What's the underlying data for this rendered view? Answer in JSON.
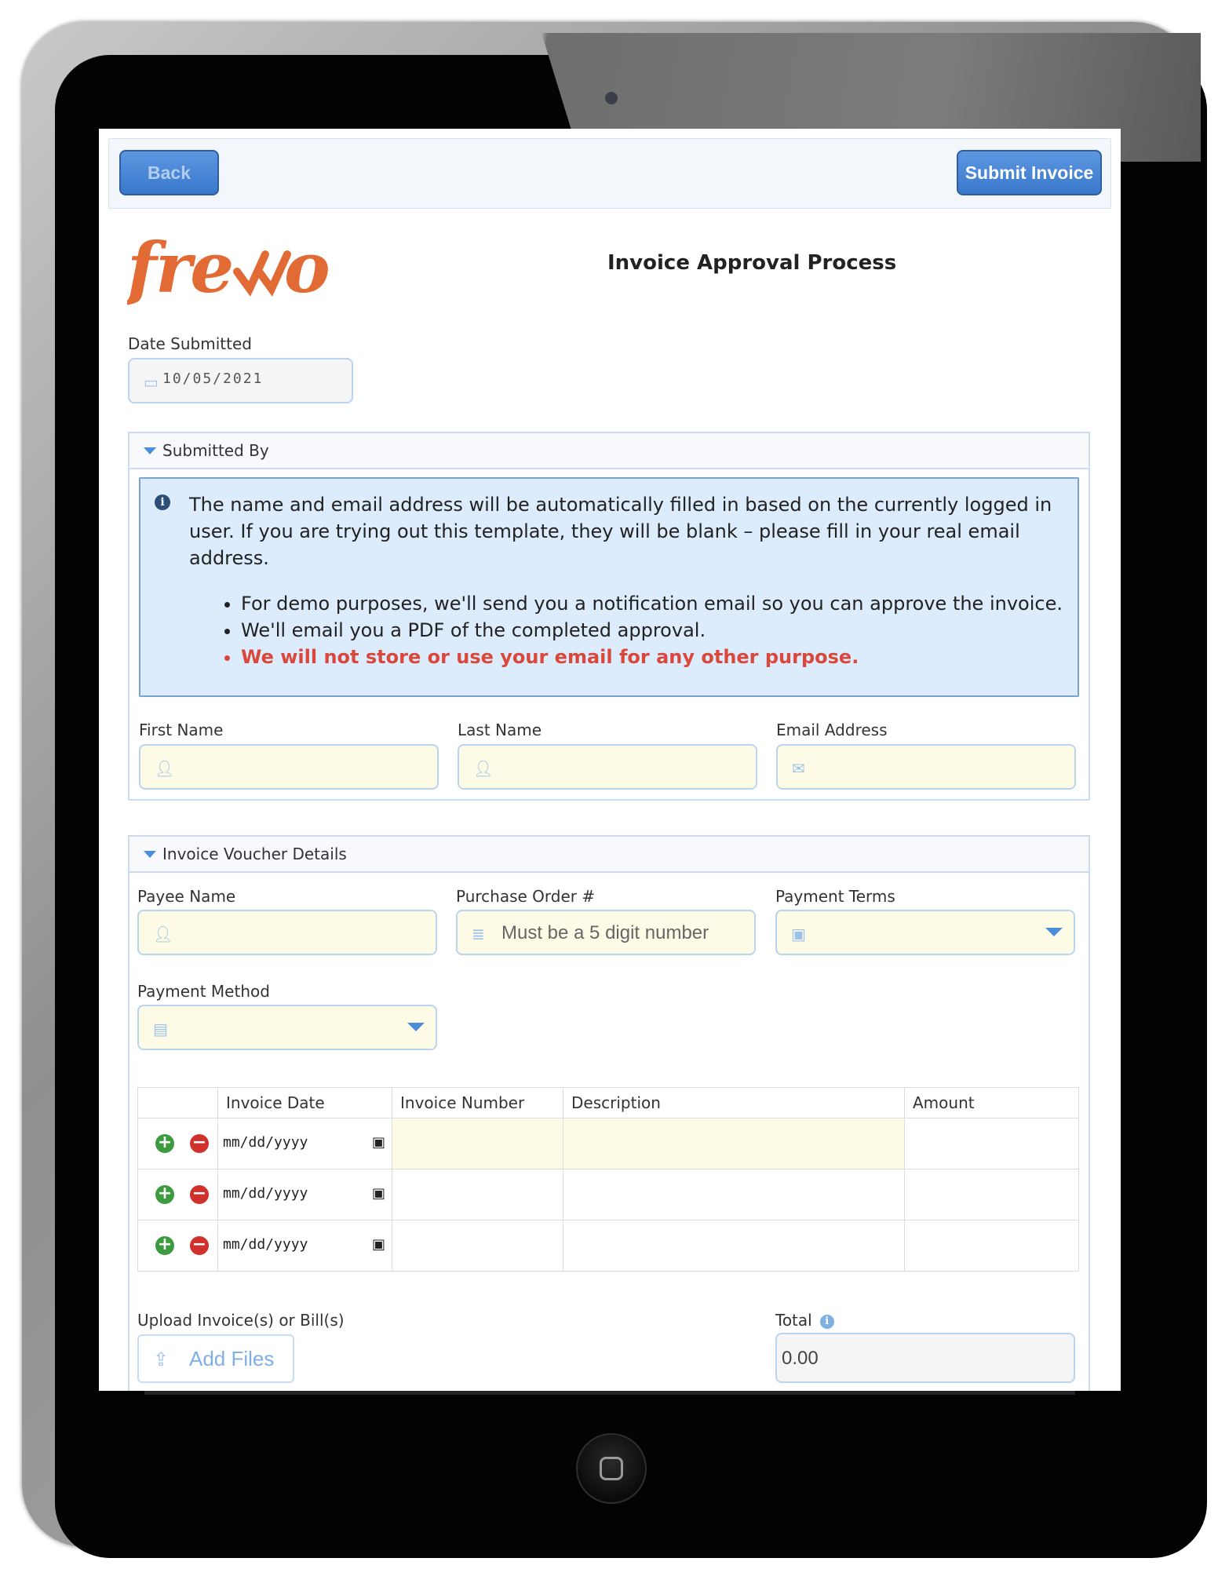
{
  "toolbar": {
    "back_label": "Back",
    "submit_label": "Submit Invoice"
  },
  "header": {
    "logo_text": "frevvo",
    "title": "Invoice Approval Process"
  },
  "date_submitted": {
    "label": "Date Submitted",
    "value": "10/05/2021"
  },
  "submitted_by": {
    "title": "Submitted By",
    "info_text": "The name and email address will be automatically filled in based on the currently logged in user. If you are trying out this template, they will be blank – please fill in your real email address.",
    "bullets": [
      "For demo purposes, we'll send you a notification email so you can approve the invoice.",
      "We'll email you a PDF of the completed approval.",
      "We will not store or use your email for any other purpose."
    ],
    "first_name_label": "First Name",
    "last_name_label": "Last Name",
    "email_label": "Email Address"
  },
  "invoice_details": {
    "title": "Invoice Voucher Details",
    "payee_label": "Payee Name",
    "po_label": "Purchase Order #",
    "po_placeholder": "Must be a 5 digit number",
    "terms_label": "Payment Terms",
    "method_label": "Payment Method",
    "table": {
      "headers": [
        "Invoice Date",
        "Invoice Number",
        "Description",
        "Amount"
      ],
      "rows": [
        {
          "date": "mm/dd/yyyy"
        },
        {
          "date": "mm/dd/yyyy"
        },
        {
          "date": "mm/dd/yyyy"
        }
      ]
    },
    "upload_label": "Upload Invoice(s) or Bill(s)",
    "add_files_label": "Add Files",
    "total_label": "Total",
    "total_value": "0.00"
  },
  "colors": {
    "brand": "#e26b35",
    "accent": "#3a78cc",
    "field_fill": "#fdfbe6",
    "warning_text": "#d9483b"
  }
}
